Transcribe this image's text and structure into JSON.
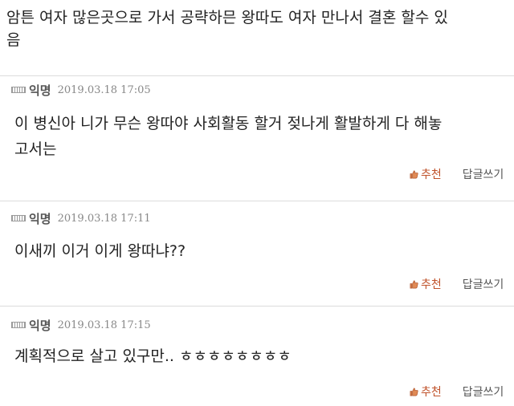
{
  "post": {
    "body": "암튼 여자 많은곳으로 가서 공략하믄 왕따도 여자 만나서 결혼 할수 있\n음"
  },
  "comments": [
    {
      "author": "익명",
      "date": "2019.03.18 17:05",
      "text": "이 병신아 니가 무슨 왕따야 사회활동 할거 젖나게 활발하게 다 해놓\n고서는",
      "like_label": "추천",
      "reply_label": "답글쓰기"
    },
    {
      "author": "익명",
      "date": "2019.03.18 17:11",
      "text": "이새끼 이거 이게 왕따냐??",
      "like_label": "추천",
      "reply_label": "답글쓰기"
    },
    {
      "author": "익명",
      "date": "2019.03.18 17:15",
      "text": "계획적으로 살고 있구만.. ㅎㅎㅎㅎㅎㅎㅎㅎ",
      "like_label": "추천",
      "reply_label": "답글쓰기"
    }
  ],
  "icons": {
    "user": "user-icon",
    "like": "thumbs-up-icon"
  },
  "colors": {
    "like": "#c0522a",
    "divider": "#dcdcdc"
  }
}
